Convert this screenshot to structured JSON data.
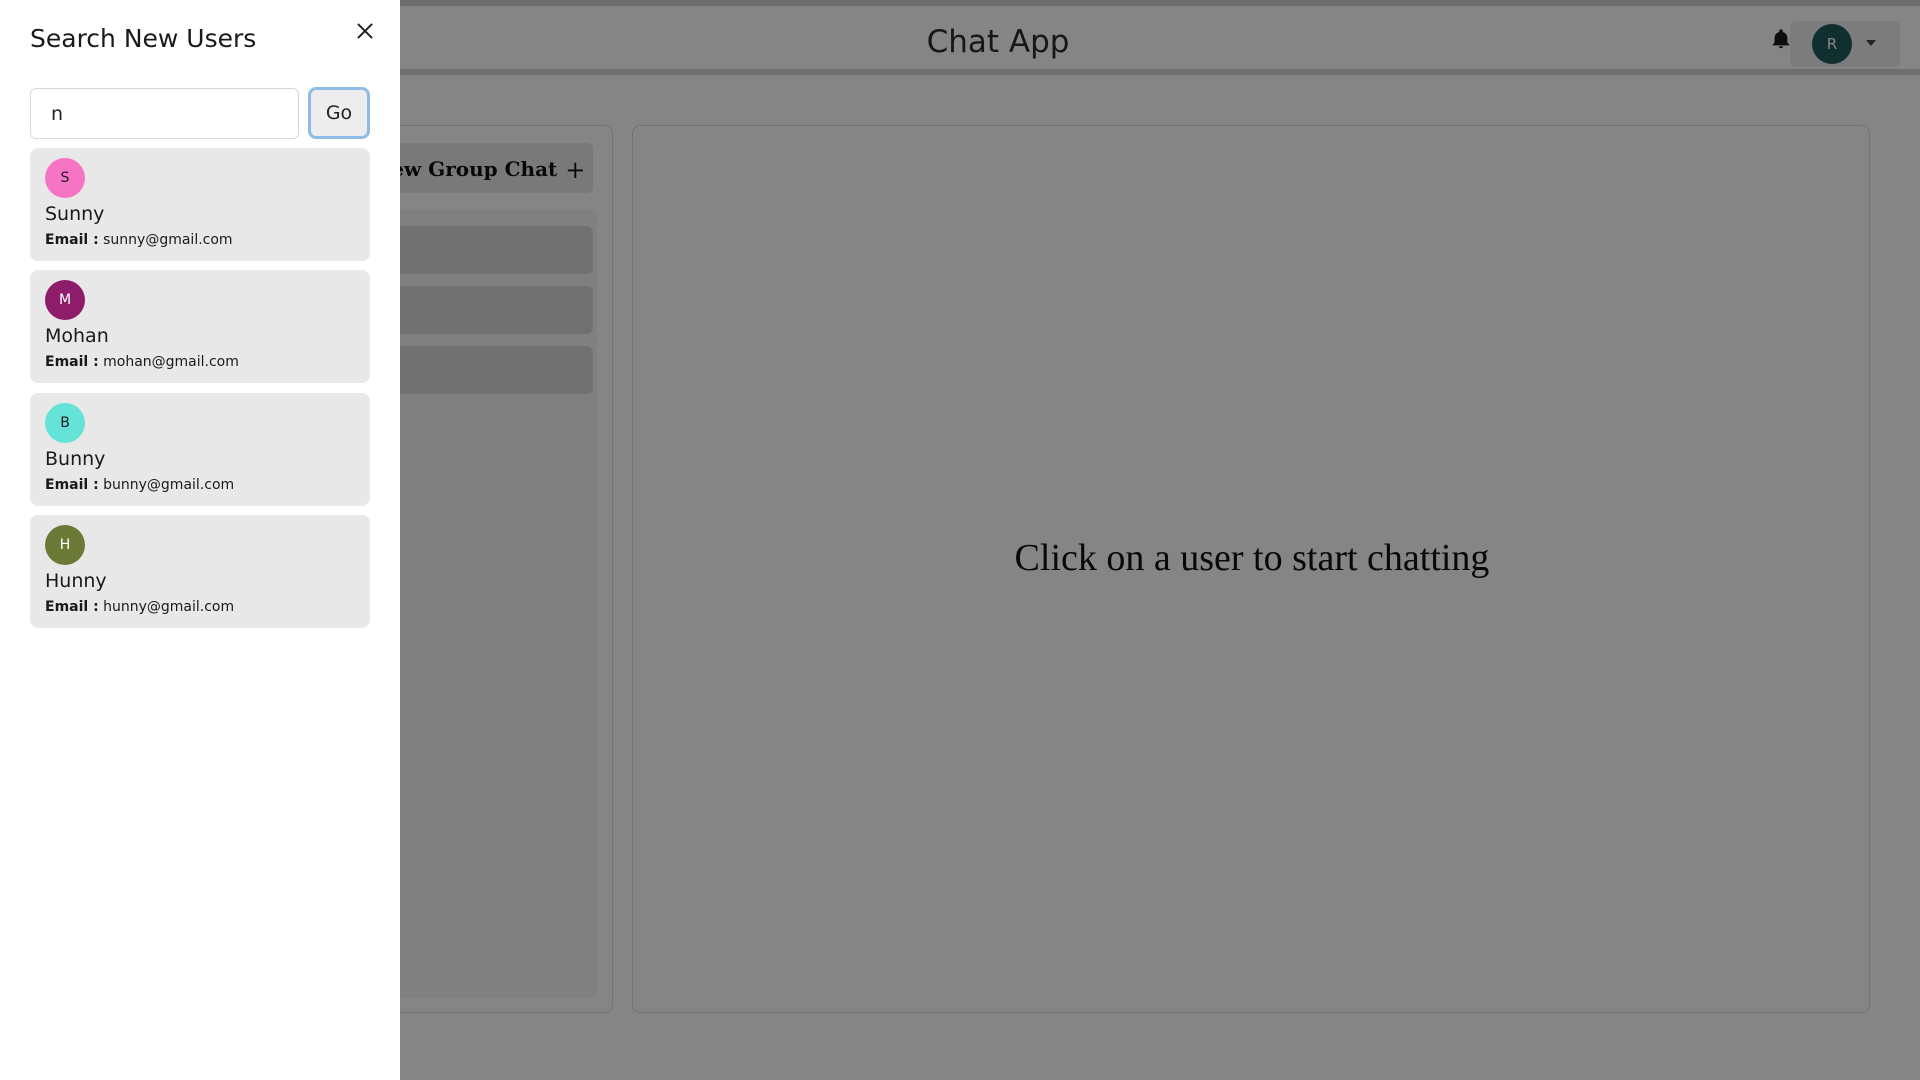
{
  "header": {
    "title": "Chat App",
    "profile_initial": "R"
  },
  "sidebar": {
    "new_group_label": "New Group Chat",
    "plus_glyph": "+",
    "chat_items": [
      {},
      {},
      {}
    ]
  },
  "main": {
    "placeholder": "Click on a user to start chatting"
  },
  "drawer": {
    "title": "Search New Users",
    "search": {
      "value": "n"
    },
    "go_label": "Go",
    "email_label": "Email :",
    "results": [
      {
        "initial": "S",
        "name": "Sunny",
        "email": "sunny@gmail.com",
        "avatar_color": "#f774c4",
        "text_color": "#1a1a1a"
      },
      {
        "initial": "M",
        "name": "Mohan",
        "email": "mohan@gmail.com",
        "avatar_color": "#8f1b6b",
        "text_color": "#ffffff"
      },
      {
        "initial": "B",
        "name": "Bunny",
        "email": "bunny@gmail.com",
        "avatar_color": "#66e3d8",
        "text_color": "#1a1a1a"
      },
      {
        "initial": "H",
        "name": "Hunny",
        "email": "hunny@gmail.com",
        "avatar_color": "#6b7a36",
        "text_color": "#ffffff"
      }
    ]
  }
}
